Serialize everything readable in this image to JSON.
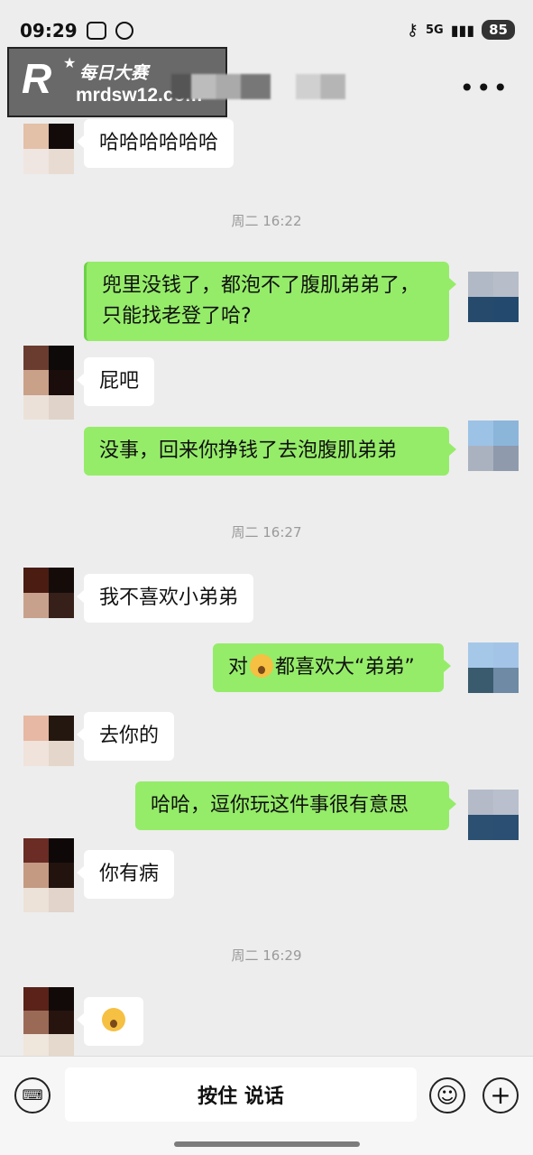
{
  "status_bar": {
    "time": "09:29",
    "network": "5G",
    "battery": "85"
  },
  "header": {
    "watermark_logo": "R",
    "watermark_title": "每日大赛",
    "watermark_url": "mrdsw12.com",
    "more_icon": "more-icon"
  },
  "messages": [
    {
      "side": "left",
      "text": "哈哈哈哈哈哈"
    },
    {
      "type": "time",
      "text": "周二 16:22"
    },
    {
      "side": "right",
      "text": "兜里没钱了，都泡不了腹肌弟弟了，",
      "text2": "只能找老登了哈?"
    },
    {
      "side": "left",
      "text": "屁吧"
    },
    {
      "side": "right",
      "text": "没事，回来你挣钱了去泡腹肌弟弟"
    },
    {
      "type": "time",
      "text": "周二 16:27"
    },
    {
      "side": "left",
      "text": "我不喜欢小弟弟"
    },
    {
      "side": "right",
      "text_a": "对",
      "text_b": "都喜欢大“弟弟”",
      "emoji": "laughing-crying-emoji"
    },
    {
      "side": "left",
      "text": "去你的"
    },
    {
      "side": "right",
      "text": "哈哈，逗你玩这件事很有意思"
    },
    {
      "side": "left",
      "text": "你有病"
    },
    {
      "type": "time",
      "text": "周二 16:29"
    },
    {
      "side": "left",
      "emoji": "face-emoji"
    }
  ],
  "input_bar": {
    "voice_label": "按住 说话",
    "keyboard_icon": "keyboard-icon",
    "emoji_icon": "emoji-icon",
    "plus_icon": "plus-icon"
  },
  "colors": {
    "background": "#ededed",
    "bubble_self": "#95ec69",
    "bubble_other": "#ffffff",
    "timestamp": "#9a9a9a"
  }
}
